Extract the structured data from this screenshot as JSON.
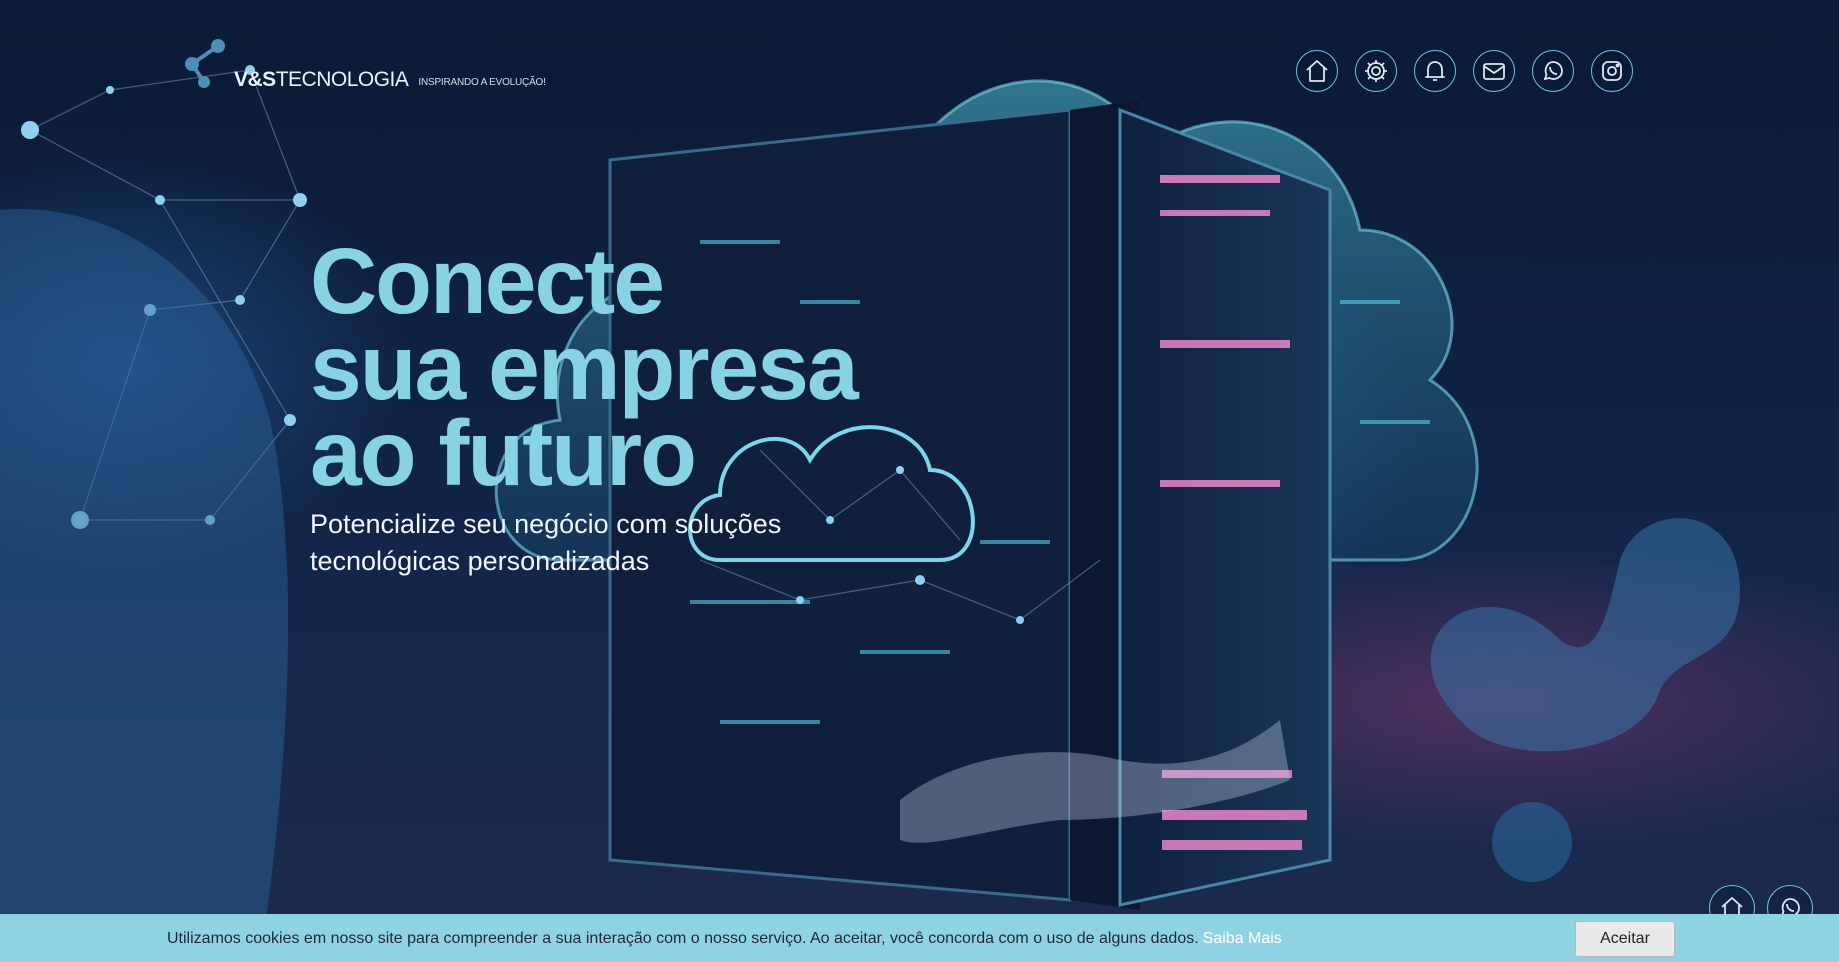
{
  "header": {
    "brand_bold": "V&S",
    "brand_rest": "TECNOLOGIA",
    "tagline": "INSPIRANDO A EVOLUÇÃO!",
    "icons": [
      "home-icon",
      "gear-icon",
      "bell-icon",
      "mail-icon",
      "whatsapp-icon",
      "instagram-icon"
    ]
  },
  "hero": {
    "title_lines": [
      "Conecte",
      "sua empresa",
      "ao futuro"
    ],
    "subtitle_lines": [
      "Potencialize seu negócio com soluções",
      "tecnológicas personalizadas"
    ]
  },
  "floating": {
    "icons": [
      "home-icon",
      "whatsapp-icon"
    ]
  },
  "cookie": {
    "text": "Utilizamos cookies em nosso site para compreender a sua interação com o nosso serviço. Ao aceitar, você concorda com o uso de alguns dados.",
    "link": "Saiba Mais",
    "accept": "Aceitar"
  },
  "colors": {
    "accent": "#87d3e3",
    "icon_stroke": "#6fc3d6",
    "cookie_bar": "#8fd3e2",
    "background": "#0c1a33"
  }
}
